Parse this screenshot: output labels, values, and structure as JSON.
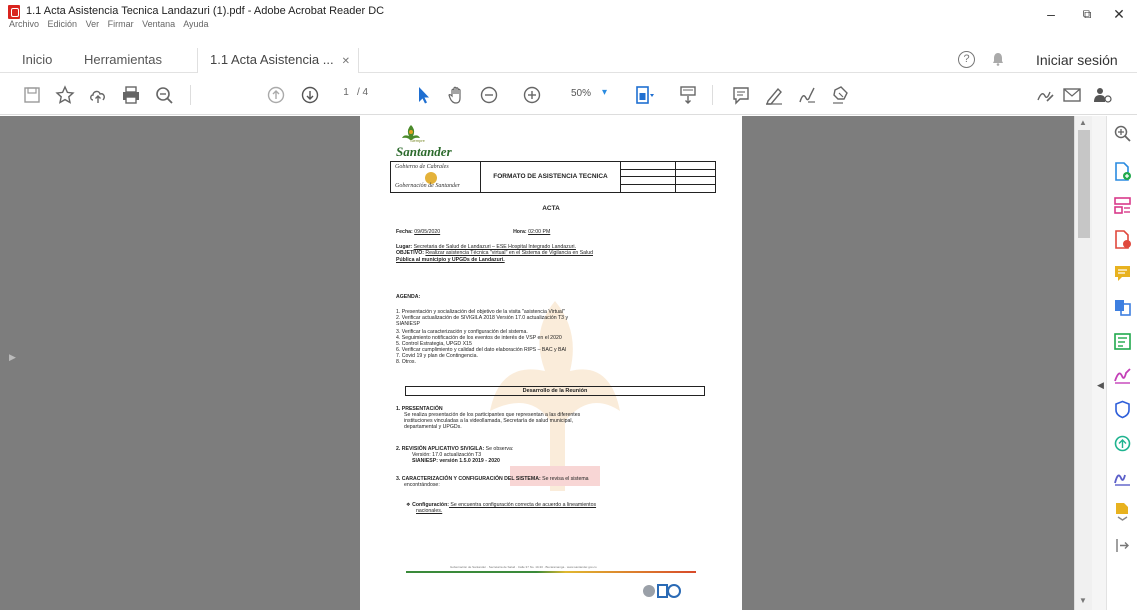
{
  "window": {
    "title": "1.1 Acta Asistencia Tecnica Landazuri (1).pdf - Adobe Acrobat Reader DC",
    "menu": [
      "Archivo",
      "Edición",
      "Ver",
      "Firmar",
      "Ventana",
      "Ayuda"
    ],
    "controls": {
      "minimize": "–",
      "restore": "⧉",
      "close": "✕"
    }
  },
  "tabs": {
    "home": "Inicio",
    "tools": "Herramientas",
    "document": "1.1 Acta Asistencia ...",
    "close": "✕",
    "help": "?",
    "signin": "Iniciar sesión"
  },
  "toolbar": {
    "page_current": "1",
    "page_total": "/ 4",
    "zoom": "50%",
    "icons": [
      "save-icon",
      "bookmark-star-icon",
      "upload-cloud-icon",
      "print-icon",
      "search-zoom-icon",
      "page-up-icon",
      "page-down-icon",
      "select-arrow-icon",
      "hand-icon",
      "zoom-out-icon",
      "zoom-in-icon",
      "fit-page-icon",
      "scroll-mode-icon",
      "comment-icon",
      "highlight-pen-icon",
      "draw-icon",
      "stamp-icon",
      "sign-icon",
      "email-icon",
      "account-icon"
    ]
  },
  "right_tools": [
    "zoom-icon",
    "create-pdf-icon",
    "organize-pages-icon",
    "export-pdf-icon",
    "comment-icon",
    "combine-files-icon",
    "edit-pdf-icon",
    "fill-sign-icon",
    "protect-icon",
    "compress-icon",
    "send-sign-icon",
    "more-tools-icon",
    "expand-icon"
  ],
  "document": {
    "logo_text": "Santander",
    "logo_tiny": "Siempre",
    "header_title": "FORMATO DE ASISTENCIA TECNICA",
    "scribble_top": "Gobierno de Cabrales",
    "scribble_bottom": "Gobernación de Santander",
    "acta": "ACTA",
    "fecha_label": "Fecha:",
    "fecha_value": "09/05/2020",
    "hora_label": "Hora:",
    "hora_value": "02:00 PM",
    "lugar_label": "Lugar:",
    "lugar_value": "Secretaria de Salud de Landazuri – ESE Hospital Integrado Landazuri.",
    "objetivo_label": "OBJETIVO:",
    "objetivo_value": "Realizar asistencia Técnica \"virtual\" en el Sistema de Vigilancia en Salud",
    "objetivo_value2": "Pública al municipio y UPGDs de Landazuri.",
    "agenda_label": "AGENDA:",
    "agenda": [
      "1.     Presentación y socialización del objetivo de la visita \"asistencia Virtual\"",
      "2.     Verificar actualización de SIVIGILA 2018 Versión 17.0 actualización T3 y",
      "        SIANIESP",
      "3.     Verificar la caracterización y configuración del sistema.",
      "4.     Seguimiento notificación de los eventos de interés de VSP en el 2020",
      "5.     Control Estrategia, UPGD X15",
      "6.     Verificar cumplimiento y calidad del dato elaboración RIPS – BAC y BAI",
      "7.     Covid 19 y plan de Contingencia.",
      "8.     Otros."
    ],
    "section_title": "Desarrollo de la Reunión",
    "s1_title": "1.  PRESENTACIÓN",
    "s1_lines": [
      "Se realiza presentación de los participantes que representan a las diferentes",
      "instituciones vinculadas a la videollamada, Secretaría de salud municipal,",
      "departamental y UPGDs."
    ],
    "s2_title": "2.  REVISIÓN APLICATIVO SIVIGILA:",
    "s2_suffix": " Se observa:",
    "s2_lines": [
      "Versión: 17.0 actualización T3",
      "SIANIESP: versión 1.5.0   2019 - 2020"
    ],
    "s3_title": "3.  CARACTERIZACIÓN Y CONFIGURACIÓN DEL SISTEMA:",
    "s3_suffix": " Se revisa el sistema",
    "s3_line2": "encontrándose:",
    "s3_bullet_label": "Configuración:",
    "s3_bullet_text": " Se encuentra configuración correcta de acuerdo a lineamientos",
    "s3_bullet_text2": "nacionales.",
    "footer_text": "Gobernación de Santander  ·  Secretaría de Salud  ·  Calle 37 No. 10-30  ·  Bucaramanga  ·  www.santander.gov.co"
  },
  "colors": {
    "doc_background": "#7d7d7d",
    "accent_blue": "#2a8be0",
    "right_tools": [
      "#2a8be0",
      "#20a94c",
      "#d93a8a",
      "#e0483c",
      "#e8b21f",
      "#3d7fe0",
      "#20a94c",
      "#c440b8",
      "#2f5fd9",
      "#1fb38f",
      "#5a5ec8",
      "#e8b21f"
    ]
  }
}
